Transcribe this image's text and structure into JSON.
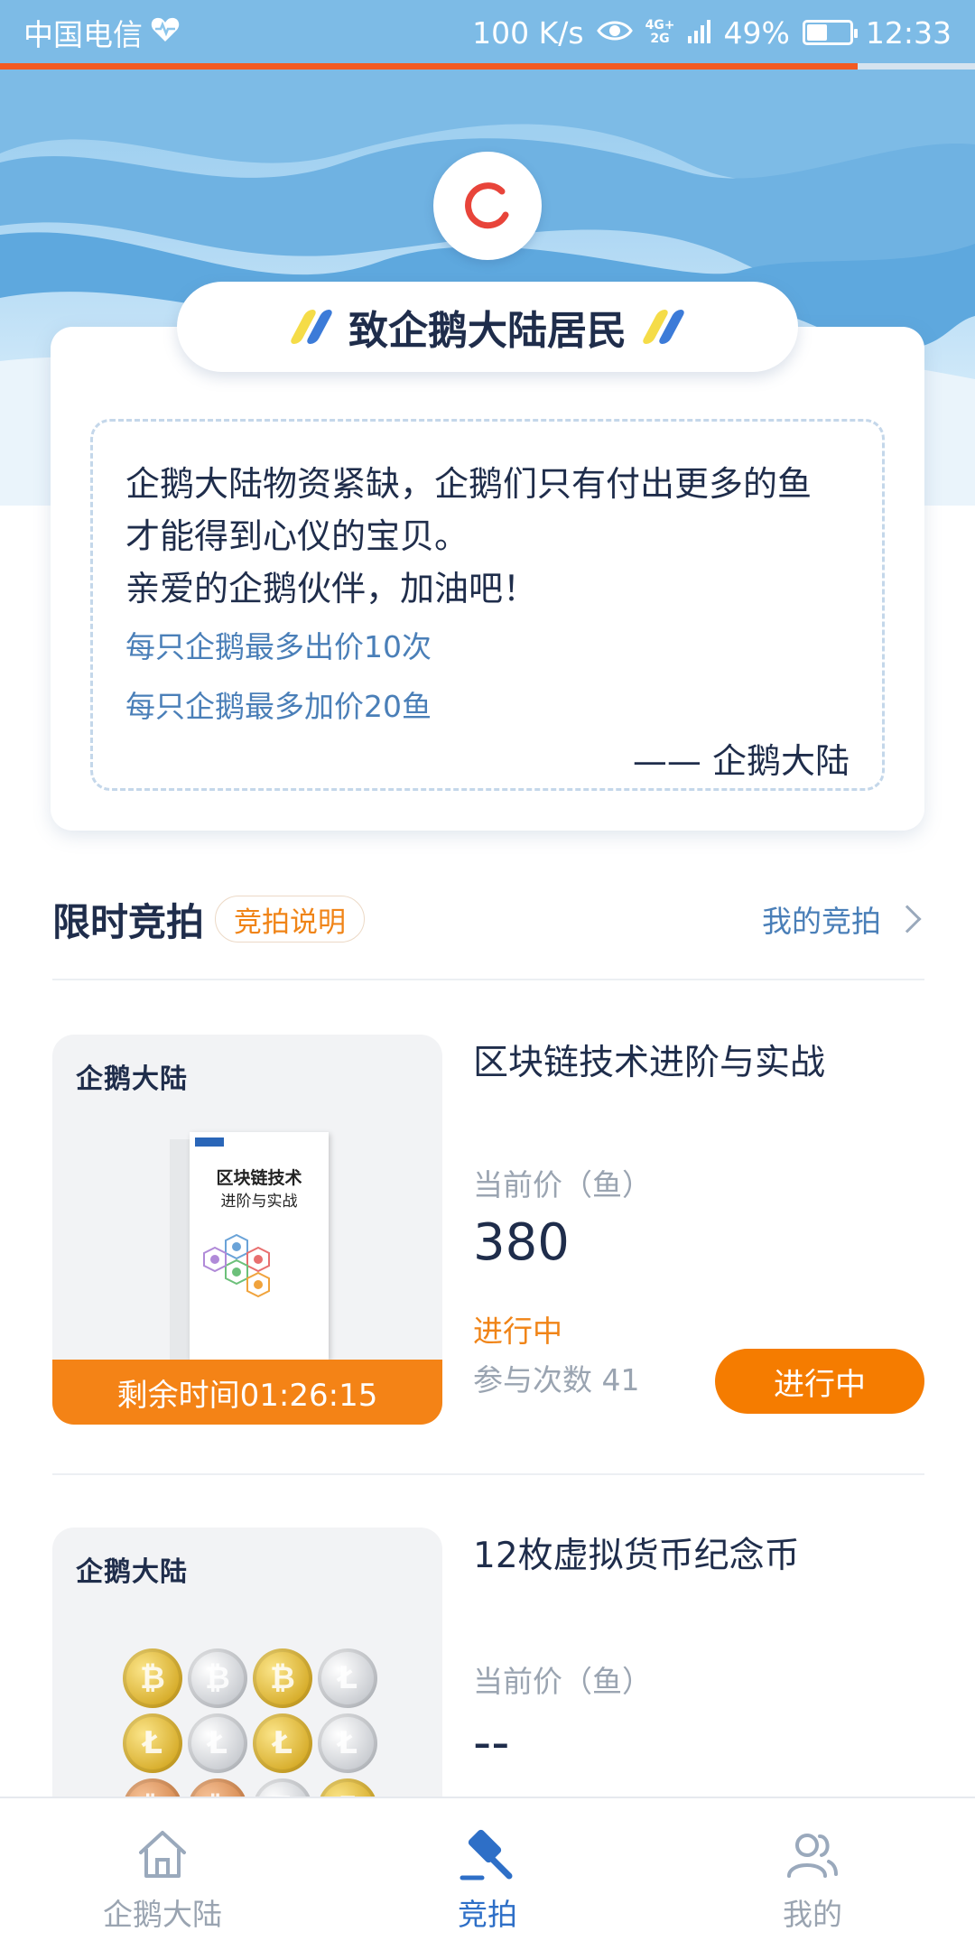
{
  "status_bar": {
    "carrier": "中国电信",
    "net_speed": "100 K/s",
    "network_top": "4G+",
    "network_bottom": "2G",
    "battery": "49%",
    "time": "12:33"
  },
  "load_progress": 0.88,
  "notice": {
    "title": "致企鹅大陆居民",
    "message_line1": "企鹅大陆物资紧缺，企鹅们只有付出更多的鱼",
    "message_line2": "才能得到心仪的宝贝。",
    "message_line3": "亲爱的企鹅伙伴，加油吧！",
    "rule1": "每只企鹅最多出价10次",
    "rule2": "每只企鹅最多加价20鱼",
    "signature": "—— 企鹅大陆"
  },
  "section": {
    "title": "限时竞拍",
    "rules_link": "竞拍说明",
    "my_auctions": "我的竞拍"
  },
  "items": [
    {
      "brand": "企鹅大陆",
      "name": "区块链技术进阶与实战",
      "price_label": "当前价（鱼）",
      "price": "380",
      "state": "进行中",
      "participants": "参与次数 41",
      "timer": "剩余时间01:26:15",
      "button": "进行中",
      "book_title_1": "区块链技术",
      "book_title_2": "进阶与实战"
    },
    {
      "brand": "企鹅大陆",
      "name": "12枚虚拟货币纪念币",
      "price_label": "当前价（鱼）",
      "price": "--"
    }
  ],
  "nav": {
    "home": "企鹅大陆",
    "auction": "竞拍",
    "mine": "我的",
    "active": "auction"
  },
  "colors": {
    "accent_orange": "#f57c00",
    "accent_blue": "#2e6fc7",
    "progress_red": "#f25a22"
  }
}
